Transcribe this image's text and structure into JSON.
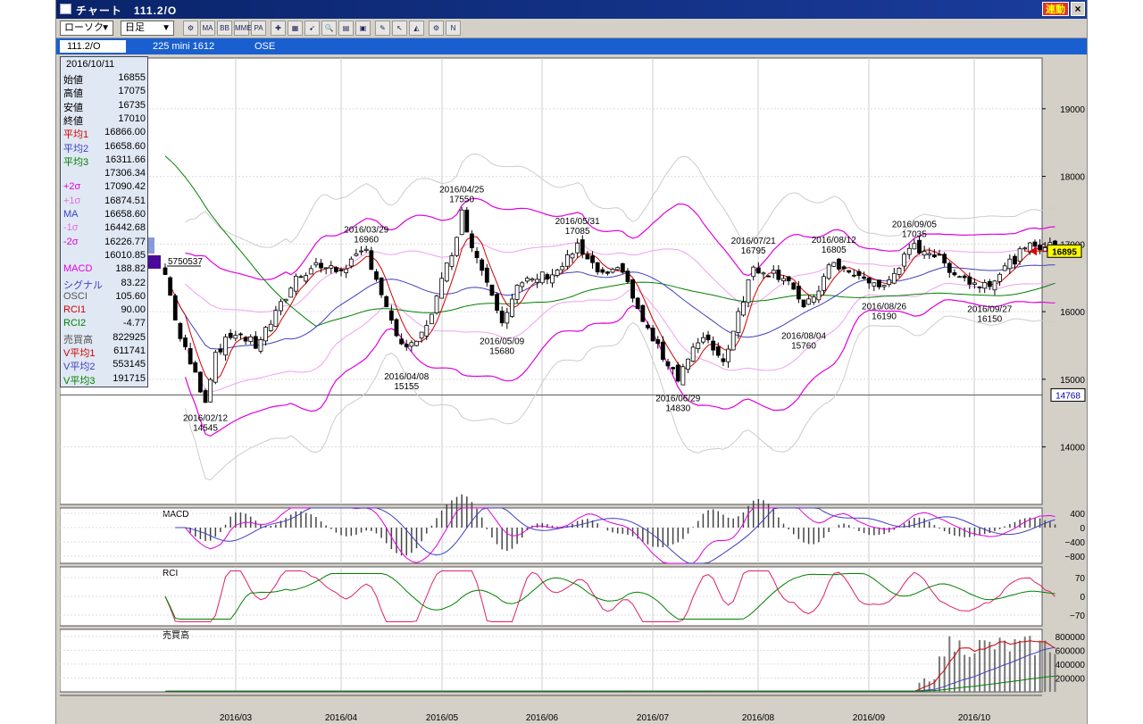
{
  "window": {
    "title": "チャート　111.2/O",
    "renkan": "連動",
    "close": "×"
  },
  "toolbar": {
    "chart_type": "ローソク",
    "period": "日足",
    "tools": [
      "MA",
      "BB",
      "MME",
      "PA"
    ]
  },
  "infobar": {
    "symbol": "111.2/O",
    "name": "225 mini 1612",
    "market": "OSE"
  },
  "info": {
    "date": "2016/10/11",
    "rows": [
      {
        "label": "始値",
        "value": "16855",
        "color": "#000"
      },
      {
        "label": "高値",
        "value": "17075",
        "color": "#000"
      },
      {
        "label": "安値",
        "value": "16735",
        "color": "#000"
      },
      {
        "label": "終値",
        "value": "17010",
        "color": "#000"
      },
      {
        "label": "平均1",
        "value": "16866.00",
        "color": "#d00000"
      },
      {
        "label": "平均2",
        "value": "16658.60",
        "color": "#4040c0"
      },
      {
        "label": "平均3",
        "value": "16311.66",
        "color": "#008000"
      },
      {
        "label": "",
        "value": "17306.34",
        "color": "#000"
      },
      {
        "label": "+2σ",
        "value": "17090.42",
        "color": "#e000e0"
      },
      {
        "label": "+1σ",
        "value": "16874.51",
        "color": "#e070e0"
      },
      {
        "label": "MA",
        "value": "16658.60",
        "color": "#4040c0"
      },
      {
        "label": "-1σ",
        "value": "16442.68",
        "color": "#e070e0"
      },
      {
        "label": "-2σ",
        "value": "16226.77",
        "color": "#e000e0"
      },
      {
        "label": "",
        "value": "16010.85",
        "color": "#000"
      },
      {
        "label": "MACD",
        "value": "188.82",
        "color": "#e000e0"
      },
      {
        "label": "シグナル",
        "value": "83.22",
        "color": "#4040c0"
      },
      {
        "label": "OSCI",
        "value": "105.60",
        "color": "#555"
      },
      {
        "label": "RCI1",
        "value": "90.00",
        "color": "#d00000"
      },
      {
        "label": "RCI2",
        "value": "-4.77",
        "color": "#008000"
      },
      {
        "label": "売買高",
        "value": "822925",
        "color": "#555"
      },
      {
        "label": "V平均1",
        "value": "611741",
        "color": "#d00000"
      },
      {
        "label": "V平均2",
        "value": "553145",
        "color": "#4040c0"
      },
      {
        "label": "V平均3",
        "value": "191715",
        "color": "#008000"
      }
    ]
  },
  "chart_data": {
    "type": "candlestick",
    "price_axis": {
      "ticks": [
        "19000",
        "18000",
        "17000",
        "16000",
        "15000",
        "14000"
      ],
      "range": [
        13150,
        19750
      ]
    },
    "current_price": "16895",
    "hline_price": "14768",
    "start_label": "5750537",
    "x_labels": [
      "2016/03",
      "2016/04",
      "2016/05",
      "2016/06",
      "2016/07",
      "2016/08",
      "2016/09",
      "2016/10"
    ],
    "annotations": [
      {
        "date": "2016/02/12",
        "value": "14545",
        "day": 8,
        "pos": "below"
      },
      {
        "date": "2016/03/29",
        "value": "16960",
        "day": 40,
        "pos": "above"
      },
      {
        "date": "2016/04/08",
        "value": "15155",
        "day": 48,
        "pos": "below"
      },
      {
        "date": "2016/04/25",
        "value": "17550",
        "day": 59,
        "pos": "above"
      },
      {
        "date": "2016/05/09",
        "value": "15680",
        "day": 67,
        "pos": "below"
      },
      {
        "date": "2016/05/31",
        "value": "17085",
        "day": 82,
        "pos": "above"
      },
      {
        "date": "2016/06/29",
        "value": "14830",
        "day": 102,
        "pos": "below"
      },
      {
        "date": "2016/07/21",
        "value": "16795",
        "day": 117,
        "pos": "above"
      },
      {
        "date": "2016/08/04",
        "value": "15760",
        "day": 127,
        "pos": "below"
      },
      {
        "date": "2016/08/12",
        "value": "16805",
        "day": 133,
        "pos": "above"
      },
      {
        "date": "2016/08/26",
        "value": "16190",
        "day": 143,
        "pos": "below"
      },
      {
        "date": "2016/09/05",
        "value": "17035",
        "day": 149,
        "pos": "above"
      },
      {
        "date": "2016/09/27",
        "value": "16150",
        "day": 164,
        "pos": "below"
      }
    ],
    "price_anchors": [
      [
        0,
        16550
      ],
      [
        3,
        15600
      ],
      [
        8,
        14700
      ],
      [
        10,
        15400
      ],
      [
        14,
        15700
      ],
      [
        18,
        15500
      ],
      [
        22,
        15950
      ],
      [
        26,
        16500
      ],
      [
        30,
        16700
      ],
      [
        34,
        16600
      ],
      [
        38,
        16780
      ],
      [
        40,
        16900
      ],
      [
        42,
        16500
      ],
      [
        45,
        15800
      ],
      [
        48,
        15400
      ],
      [
        51,
        15650
      ],
      [
        54,
        16200
      ],
      [
        57,
        16900
      ],
      [
        59,
        17450
      ],
      [
        62,
        16800
      ],
      [
        65,
        16300
      ],
      [
        67,
        15900
      ],
      [
        70,
        16350
      ],
      [
        74,
        16500
      ],
      [
        78,
        16600
      ],
      [
        82,
        16950
      ],
      [
        85,
        16650
      ],
      [
        88,
        16500
      ],
      [
        91,
        16650
      ],
      [
        94,
        16000
      ],
      [
        98,
        15450
      ],
      [
        102,
        15050
      ],
      [
        105,
        15450
      ],
      [
        108,
        15600
      ],
      [
        111,
        15250
      ],
      [
        114,
        16000
      ],
      [
        117,
        16650
      ],
      [
        120,
        16600
      ],
      [
        124,
        16500
      ],
      [
        127,
        16000
      ],
      [
        130,
        16350
      ],
      [
        133,
        16750
      ],
      [
        136,
        16550
      ],
      [
        140,
        16450
      ],
      [
        143,
        16350
      ],
      [
        146,
        16700
      ],
      [
        149,
        16950
      ],
      [
        152,
        16900
      ],
      [
        155,
        16700
      ],
      [
        158,
        16550
      ],
      [
        161,
        16400
      ],
      [
        164,
        16450
      ],
      [
        167,
        16650
      ],
      [
        170,
        16850
      ],
      [
        173,
        17000
      ],
      [
        176,
        16950
      ]
    ],
    "macd": {
      "ticks": [
        "400",
        "0",
        "−400",
        "−800"
      ],
      "range": [
        -1000,
        550
      ]
    },
    "rci": {
      "ticks": [
        "70",
        "0",
        "−70"
      ],
      "range": [
        -110,
        110
      ]
    },
    "volume": {
      "label": "売買高",
      "ticks": [
        "800000",
        "600000",
        "400000",
        "200000"
      ],
      "range": [
        0,
        900000
      ]
    }
  }
}
